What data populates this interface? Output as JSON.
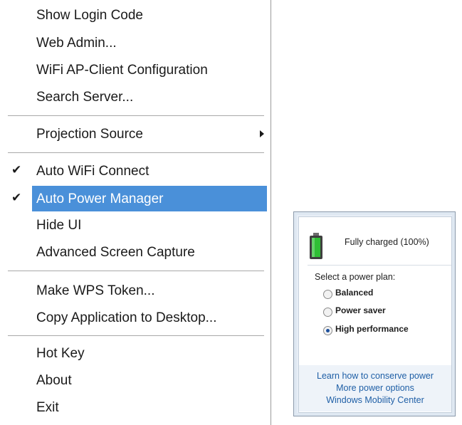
{
  "menu": {
    "items": [
      {
        "label": "Show Login Code"
      },
      {
        "label": "Web Admin..."
      },
      {
        "label": "WiFi AP-Client Configuration"
      },
      {
        "label": "Search Server..."
      },
      {
        "label": "Projection Source"
      },
      {
        "label": "Auto WiFi Connect",
        "checked": true
      },
      {
        "label": "Auto Power Manager",
        "checked": true,
        "highlighted": true
      },
      {
        "label": "Hide UI"
      },
      {
        "label": "Advanced Screen Capture"
      },
      {
        "label": "Make WPS Token..."
      },
      {
        "label": "Copy Application to Desktop..."
      },
      {
        "label": "Hot Key"
      },
      {
        "label": "About"
      },
      {
        "label": "Exit"
      }
    ],
    "check_glyph": "✔",
    "highlight_color": "#4a90d9"
  },
  "power": {
    "status": "Fully charged (100%)",
    "prompt": "Select a power plan:",
    "plans": [
      {
        "label": "Balanced",
        "selected": false
      },
      {
        "label": "Power saver",
        "selected": false
      },
      {
        "label": "High performance",
        "selected": true
      }
    ],
    "links": [
      "Learn how to conserve power",
      "More power options",
      "Windows Mobility Center"
    ],
    "battery_level": 1.0
  }
}
